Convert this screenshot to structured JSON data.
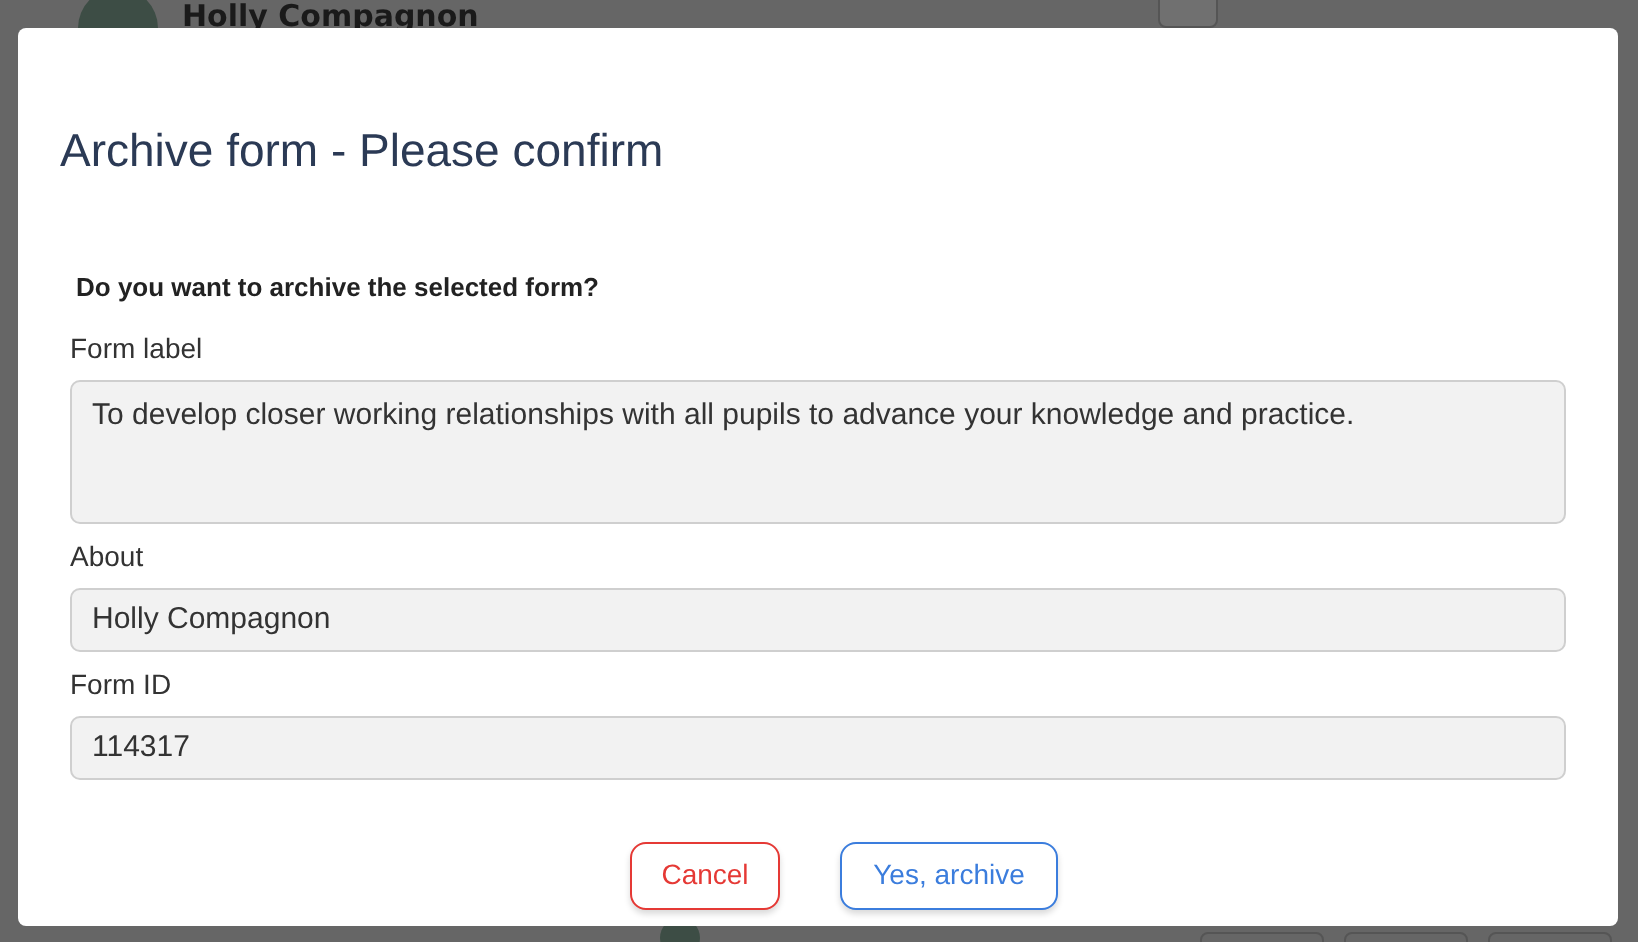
{
  "background": {
    "top_row": {
      "name": "Holly Compagnon"
    }
  },
  "dialog": {
    "title": "Archive form - Please confirm",
    "question": "Do you want to archive the selected form?",
    "fields": [
      {
        "label": "Form label",
        "value": "To develop closer working relationships with all pupils to advance your knowledge and practice.",
        "kind": "textarea"
      },
      {
        "label": "About",
        "value": "Holly Compagnon",
        "kind": "input"
      },
      {
        "label": "Form ID",
        "value": "114317",
        "kind": "input"
      }
    ],
    "buttons": [
      {
        "label": "Cancel",
        "kind": "cancel"
      },
      {
        "label": "Yes, archive",
        "kind": "confirm"
      }
    ]
  }
}
